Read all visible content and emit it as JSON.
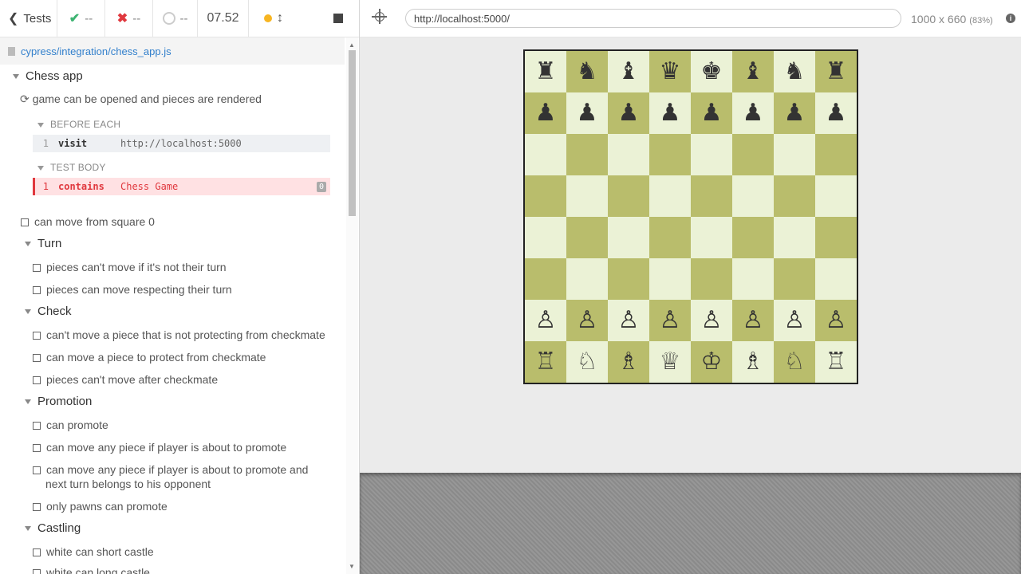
{
  "reporter": {
    "tests_label": "Tests",
    "passed": "--",
    "failed": "--",
    "pending": "--",
    "duration": "07.52",
    "spec_path": "cypress/integration/chess_app.js"
  },
  "tree": {
    "root": "Chess app",
    "running_test": "game can be opened and pieces are rendered",
    "before_each_label": "BEFORE EACH",
    "before_cmd": {
      "num": "1",
      "name": "visit",
      "arg": "http://localhost:5000"
    },
    "test_body_label": "TEST BODY",
    "body_cmd": {
      "num": "1",
      "name": "contains",
      "arg": "Chess Game",
      "badge": "0"
    },
    "test_move": "can move from square 0",
    "suites": [
      {
        "title": "Turn",
        "tests": [
          "pieces can't move if it's not their turn",
          "pieces can move respecting their turn"
        ]
      },
      {
        "title": "Check",
        "tests": [
          "can't move a piece that is not protecting from checkmate",
          "can move a piece to protect from checkmate",
          "pieces can't move after checkmate"
        ]
      },
      {
        "title": "Promotion",
        "tests": [
          "can promote",
          "can move any piece if player is about to promote",
          "can move any piece if player is about to promote and",
          "next turn belongs to his opponent",
          "only pawns can promote"
        ]
      },
      {
        "title": "Castling",
        "tests": [
          "white can short castle",
          "white can long castle"
        ]
      }
    ]
  },
  "runner": {
    "url": "http://localhost:5000/",
    "viewport": "1000 x 660",
    "scale": "(83%)"
  },
  "board": {
    "ranks": [
      [
        "♜",
        "♞",
        "♝",
        "♛",
        "♚",
        "♝",
        "♞",
        "♜"
      ],
      [
        "♟",
        "♟",
        "♟",
        "♟",
        "♟",
        "♟",
        "♟",
        "♟"
      ],
      [
        "",
        "",
        "",
        "",
        "",
        "",
        "",
        ""
      ],
      [
        "",
        "",
        "",
        "",
        "",
        "",
        "",
        ""
      ],
      [
        "",
        "",
        "",
        "",
        "",
        "",
        "",
        ""
      ],
      [
        "",
        "",
        "",
        "",
        "",
        "",
        "",
        ""
      ],
      [
        "♙",
        "♙",
        "♙",
        "♙",
        "♙",
        "♙",
        "♙",
        "♙"
      ],
      [
        "♖",
        "♘",
        "♗",
        "♕",
        "♔",
        "♗",
        "♘",
        "♖"
      ]
    ]
  }
}
